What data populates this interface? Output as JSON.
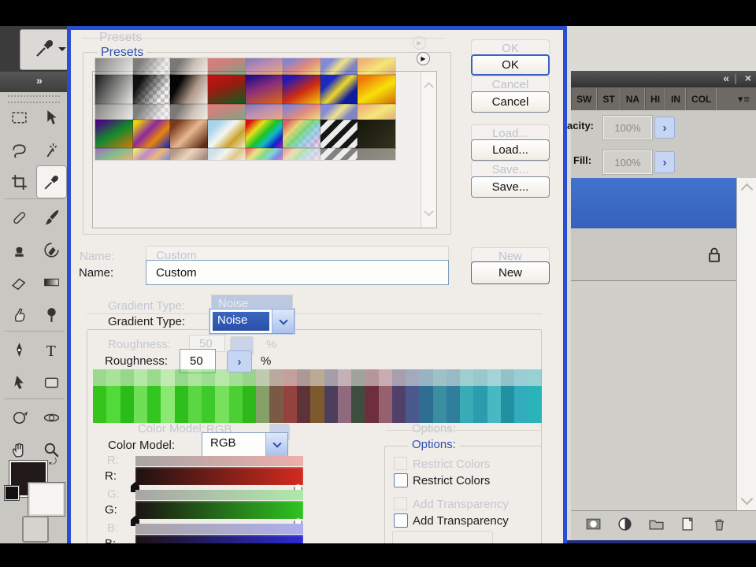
{
  "dialog": {
    "presets_label": "Presets",
    "name_label": "Name:",
    "name_value": "Custom",
    "gradient_type_label": "Gradient Type:",
    "gradient_type_value": "Noise",
    "roughness_label": "Roughness:",
    "roughness_value": "50",
    "roughness_unit": "%",
    "color_model_label": "Color Model:",
    "color_model_value": "RGB",
    "options_label": "Options:",
    "restrict_colors_label": "Restrict Colors",
    "add_transparency_label": "Add Transparency",
    "buttons": {
      "ok": "OK",
      "cancel": "Cancel",
      "load": "Load...",
      "save": "Save...",
      "new": "New"
    },
    "accent_blue": "#2a4ed2",
    "sliders": [
      {
        "label": "R:",
        "color": "#d42a1e"
      },
      {
        "label": "G:",
        "color": "#2ec421"
      },
      {
        "label": "B:",
        "color": "#2b2bd4"
      }
    ],
    "preset_swatches": [
      [
        {
          "bg": "linear-gradient(120deg,#181818,#e8e8e6)"
        },
        {
          "bg": "linear-gradient(120deg,#101010 20%,rgba(16,16,16,0) 75%),repeating-conic-gradient(#bfbfbf 0 25%,#f2f2f2 0 50%)",
          "size": "auto,10px 10px"
        },
        {
          "bg": "linear-gradient(120deg,#050505 25%,#b0988a 60%,#f2efe9)"
        },
        {
          "bg": "linear-gradient(160deg,#cc1111,#9b1b10 40%,#0b5e20)"
        },
        {
          "bg": "linear-gradient(160deg,#2a0f86 10%,#8c2f7a 45%,#e2690a)"
        },
        {
          "bg": "linear-gradient(150deg,#2318b5 15%,#cf2a12 55%,#f5cf0a)"
        },
        {
          "bg": "linear-gradient(135deg,#1c2ac0 25%,#f0d82a 50%,#101c9e 75%)"
        },
        {
          "bg": "linear-gradient(150deg,#f07a0a 15%,#f7e00a 55%,#cf6a08)"
        }
      ],
      [
        {
          "bg": "linear-gradient(150deg,#4a0a80 10%,#138a2a 50%,#e07408)"
        },
        {
          "bg": "linear-gradient(135deg,#f2cf08 10%,#8a2a9e 40%,#e8840a 65%,#1e2eb8 95%)"
        },
        {
          "bg": "linear-gradient(135deg,#7a3a1e 15%,#e8b890 50%,#5e2c16 90%)"
        },
        {
          "bg": "linear-gradient(135deg,#a8d4ea 20%,#f6f6f2 45%,#caa22a 70%,#f2ead8)"
        },
        {
          "bg": "linear-gradient(135deg,#e01010 10%,#e6e01a 30%,#19c425 50%,#15b8c8 65%,#1420cc 82%,#c016c0)"
        },
        {
          "bg": "linear-gradient(135deg,rgba(224,90,90,.95) 10%,rgba(230,212,106,.9) 30%,rgba(106,212,112,.85) 48%,rgba(120,200,230,.7) 65%,rgba(200,140,220,.45) 85%,rgba(255,255,255,0)),repeating-conic-gradient(#c4c4c4 0 25%,#f4f4f4 0 50%)",
          "size": "auto,10px 10px"
        },
        {
          "bg": "repeating-linear-gradient(135deg,#161616 0 7px,#ececec 7px 14px)"
        },
        {
          "bg": "linear-gradient(135deg,#15150c,#33331e)"
        }
      ]
    ],
    "noise_band_colors": [
      "#35c41c",
      "#52d93a",
      "#2bbd17",
      "#6fe055",
      "#33c520",
      "#8ae873",
      "#2fbf1d",
      "#5ad743",
      "#3fca2b",
      "#77e15e",
      "#4ccf35",
      "#2eb81a",
      "#86a06a",
      "#7a5a44",
      "#93423f",
      "#5e3337",
      "#7c5a2e",
      "#4e3e5e",
      "#8f6a7e",
      "#3e4e3e",
      "#6e2e3e",
      "#96606e",
      "#50406a",
      "#49598c",
      "#2e6e93",
      "#3b8da0",
      "#2e7e9c",
      "#39abb6",
      "#2a9cad",
      "#48b8c3",
      "#21909f",
      "#32acbc",
      "#2bb3ba"
    ]
  },
  "toolbar": {
    "header_collapse_icon": "»",
    "tools": [
      [
        "rectangular-marquee",
        "move"
      ],
      [
        "lasso",
        "magic-wand"
      ],
      [
        "crop",
        "eyedropper"
      ],
      [
        "spot-healing",
        "brush"
      ],
      [
        "clone-stamp",
        "history-brush"
      ],
      [
        "eraser",
        "gradient"
      ],
      [
        "smudge",
        "dodge"
      ],
      [
        "pen",
        "type"
      ],
      [
        "path-select",
        "shape"
      ],
      [
        "rotate-3d",
        "orbit-3d"
      ],
      [
        "hand",
        "zoom"
      ]
    ],
    "selected_tool": "eyedropper"
  },
  "right_panel": {
    "header_collapse_icon": "«",
    "header_close_icon": "×",
    "tabs": [
      "SW",
      "ST",
      "NA",
      "HI",
      "IN",
      "COL"
    ],
    "opacity_label": "Opacity:",
    "opacity_value": "100%",
    "fill_label": "Fill:",
    "fill_value": "100%",
    "arrow_glyph": "›",
    "bottom_icons": [
      "layer-mask",
      "adjustment-layer",
      "group-folder",
      "new-layer",
      "delete-layer"
    ],
    "selected_layer_color": "#3b6cc6"
  }
}
